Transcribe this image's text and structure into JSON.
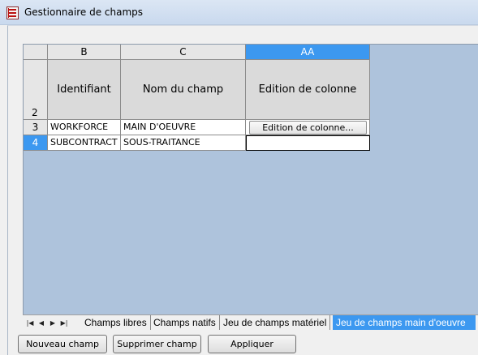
{
  "window": {
    "title": "Gestionnaire de champs"
  },
  "grid": {
    "columns": [
      "B",
      "C",
      "AA"
    ],
    "field_headers": [
      "Identifiant",
      "Nom du champ",
      "Edition de colonne"
    ],
    "header_row_number": "2",
    "rows": [
      {
        "number": "3",
        "identifiant": "WORKFORCE",
        "nom": "MAIN D'OEUVRE",
        "edition": "Edition de colonne..."
      },
      {
        "number": "4",
        "identifiant": "SUBCONTRACT",
        "nom": "SOUS-TRAITANCE",
        "edition": ""
      }
    ]
  },
  "tabs": [
    "Champs libres",
    "Champs natifs",
    "Jeu de champs matériel",
    "Jeu de champs main d'oeuvre"
  ],
  "active_tab": "Jeu de champs main d'oeuvre",
  "buttons": {
    "new_field": "Nouveau champ",
    "delete_field": "Supprimer champ",
    "apply": "Appliquer"
  },
  "colors": {
    "selection": "#3c98f0",
    "sheet_background": "#aec3dc"
  }
}
